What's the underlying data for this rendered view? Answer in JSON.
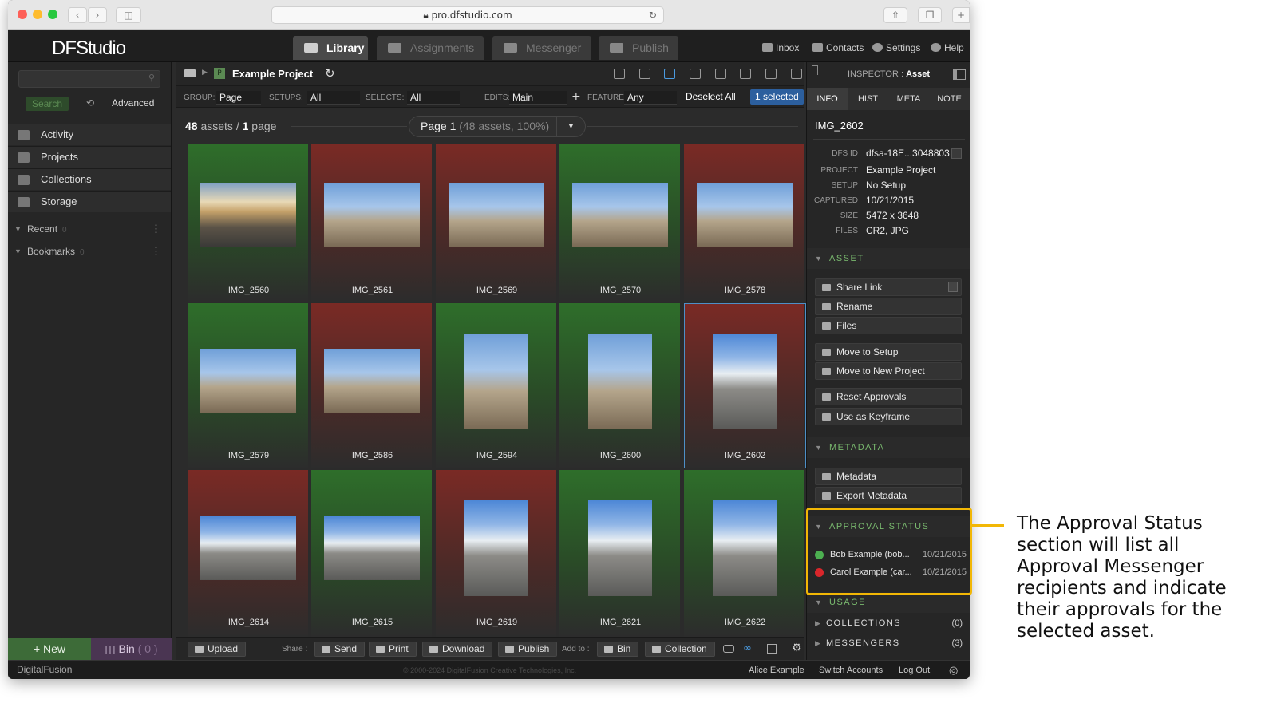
{
  "browser": {
    "url": "pro.dfstudio.com"
  },
  "app": {
    "logo": "DFStudio",
    "tabs": [
      {
        "label": "Library",
        "active": true
      },
      {
        "label": "Assignments",
        "active": false
      },
      {
        "label": "Messenger",
        "active": false
      },
      {
        "label": "Publish",
        "active": false
      }
    ],
    "top_links": [
      "Inbox",
      "Contacts",
      "Settings",
      "Help"
    ]
  },
  "sidebar": {
    "search_button": "Search",
    "advanced": "Advanced",
    "items": [
      "Activity",
      "Projects",
      "Collections",
      "Storage"
    ],
    "sections": [
      {
        "label": "Recent",
        "count": "0"
      },
      {
        "label": "Bookmarks",
        "count": "0"
      }
    ],
    "new_button": "+ New",
    "bin_label": "Bin",
    "bin_count": "( 0 )"
  },
  "main": {
    "project_name": "Example Project",
    "filters": {
      "group_label": "GROUP:",
      "group_value": "Page",
      "setups_label": "SETUPS:",
      "setups_value": "All",
      "selects_label": "SELECTS:",
      "selects_value": "All",
      "edits_label": "EDITS:",
      "edits_value": "Main",
      "feature_label": "FEATURE:",
      "feature_value": "Any",
      "deselect": "Deselect All",
      "selected": "1 selected"
    },
    "assets_count": "48",
    "assets_text": "assets /",
    "pages_count": "1",
    "pages_text": "page",
    "page_selector": "Page 1",
    "page_selector_detail": "(48 assets, 100%)",
    "assets": [
      {
        "name": "IMG_2560",
        "status": "green"
      },
      {
        "name": "IMG_2561",
        "status": "red"
      },
      {
        "name": "IMG_2569",
        "status": "red"
      },
      {
        "name": "IMG_2570",
        "status": "green"
      },
      {
        "name": "IMG_2578",
        "status": "red"
      },
      {
        "name": "IMG_2579",
        "status": "green"
      },
      {
        "name": "IMG_2586",
        "status": "red"
      },
      {
        "name": "IMG_2594",
        "status": "green"
      },
      {
        "name": "IMG_2600",
        "status": "green"
      },
      {
        "name": "IMG_2602",
        "status": "red"
      },
      {
        "name": "IMG_2614",
        "status": "red"
      },
      {
        "name": "IMG_2615",
        "status": "green"
      },
      {
        "name": "IMG_2619",
        "status": "red"
      },
      {
        "name": "IMG_2621",
        "status": "green"
      },
      {
        "name": "IMG_2622",
        "status": "green"
      }
    ],
    "bottom": {
      "upload": "Upload",
      "share_label": "Share :",
      "send": "Send",
      "print": "Print",
      "download": "Download",
      "publish": "Publish",
      "add_to_label": "Add to :",
      "bin": "Bin",
      "collection": "Collection"
    }
  },
  "inspector": {
    "title_prefix": "INSPECTOR :",
    "title": "Asset",
    "tabs": [
      "INFO",
      "HIST",
      "META",
      "NOTE"
    ],
    "asset_name": "IMG_2602",
    "fields": [
      {
        "key": "DFS ID",
        "value": "dfsa-18E...3048803"
      },
      {
        "key": "PROJECT",
        "value": "Example Project"
      },
      {
        "key": "SETUP",
        "value": "No Setup"
      },
      {
        "key": "CAPTURED",
        "value": "10/21/2015"
      },
      {
        "key": "SIZE",
        "value": "5472 x 3648"
      },
      {
        "key": "FILES",
        "value": "CR2, JPG"
      }
    ],
    "asset_section": "ASSET",
    "asset_actions": [
      "Share Link",
      "Rename",
      "Files",
      "Move to Setup",
      "Move to New Project",
      "Reset Approvals",
      "Use as Keyframe"
    ],
    "metadata_section": "METADATA",
    "metadata_actions": [
      "Metadata",
      "Export Metadata"
    ],
    "approval_section": "APPROVAL STATUS",
    "approvals": [
      {
        "name": "Bob Example (bob...",
        "date": "10/21/2015",
        "color": "#4caf50"
      },
      {
        "name": "Carol Example (car...",
        "date": "10/21/2015",
        "color": "#d9262b"
      }
    ],
    "usage_section": "USAGE",
    "collections_label": "COLLECTIONS",
    "collections_count": "(0)",
    "messengers_label": "MESSENGERS",
    "messengers_count": "(3)"
  },
  "status_bar": {
    "brand": "DigitalFusion",
    "copyright": "© 2000-2024 DigitalFusion Creative Technologies, Inc.",
    "user": "Alice Example",
    "switch": "Switch Accounts",
    "logout": "Log Out"
  },
  "callout": {
    "text": "The Approval Status section will list all Approval Messenger recipients and indicate their approvals for the selected asset."
  }
}
